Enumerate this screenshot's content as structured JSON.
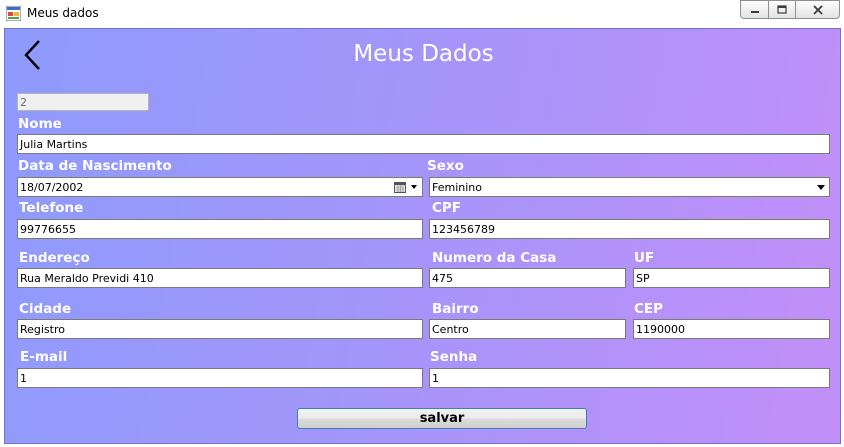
{
  "window": {
    "title": "Meus dados"
  },
  "page": {
    "heading": "Meus Dados",
    "id_value": "2"
  },
  "form": {
    "nome": {
      "label": "Nome",
      "value": "Julia Martins"
    },
    "data_nascimento": {
      "label": "Data de Nascimento",
      "value": "18/07/2002"
    },
    "sexo": {
      "label": "Sexo",
      "value": "Feminino"
    },
    "telefone": {
      "label": "Telefone",
      "value": "99776655"
    },
    "cpf": {
      "label": "CPF",
      "value": "123456789"
    },
    "endereco": {
      "label": "Endereço",
      "value": "Rua Meraldo Previdi 410"
    },
    "numero_casa": {
      "label": "Numero da Casa",
      "value": "475"
    },
    "uf": {
      "label": "UF",
      "value": "SP"
    },
    "cidade": {
      "label": "Cidade",
      "value": "Registro"
    },
    "bairro": {
      "label": "Bairro",
      "value": "Centro"
    },
    "cep": {
      "label": "CEP",
      "value": "1190000"
    },
    "email": {
      "label": "E-mail",
      "value": "1"
    },
    "senha": {
      "label": "Senha",
      "value": "1"
    }
  },
  "actions": {
    "save_label": "salvar"
  }
}
